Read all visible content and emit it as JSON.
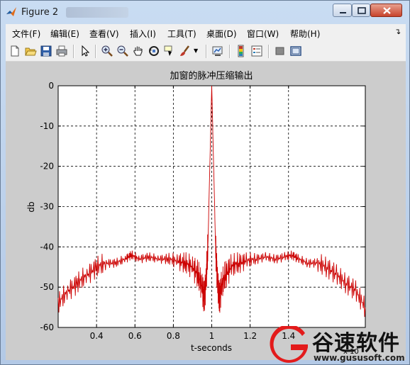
{
  "window": {
    "title": "Figure 2",
    "colors": {
      "accent": "#3a6ea5",
      "close": "#c7432b"
    }
  },
  "menu": [
    {
      "label": "文件(F)"
    },
    {
      "label": "编辑(E)"
    },
    {
      "label": "查看(V)"
    },
    {
      "label": "插入(I)"
    },
    {
      "label": "工具(T)"
    },
    {
      "label": "桌面(D)"
    },
    {
      "label": "窗口(W)"
    },
    {
      "label": "帮助(H)"
    }
  ],
  "toolbar": {
    "icons": [
      "new-figure-icon",
      "open-file-icon",
      "save-icon",
      "print-icon",
      "edit-plot-arrow-icon",
      "zoom-in-icon",
      "zoom-out-icon",
      "pan-hand-icon",
      "rotate-3d-icon",
      "data-cursor-icon",
      "brush-icon",
      "link-plot-icon",
      "colorbar-icon",
      "legend-icon",
      "hide-plot-tools-icon",
      "show-plot-tools-icon"
    ]
  },
  "chart_data": {
    "type": "line",
    "title": "加窗的脉冲压缩输出",
    "xlabel": "t-seconds",
    "ylabel": "db",
    "x_exponent_label": "x 10",
    "xlim": [
      0.2,
      1.8
    ],
    "ylim": [
      -60,
      0
    ],
    "xticks": [
      0.4,
      0.6,
      0.8,
      1.0,
      1.2,
      1.4
    ],
    "xtick_labels": [
      "0.4",
      "0.6",
      "0.8",
      "1",
      "1.2",
      "1.4"
    ],
    "yticks": [
      0,
      -10,
      -20,
      -30,
      -40,
      -50,
      -60
    ],
    "ytick_labels": [
      "0",
      "-10",
      "-20",
      "-30",
      "-40",
      "-50",
      "-60"
    ],
    "grid": true,
    "series": [
      {
        "color": "#cc0000",
        "x": [
          0.2,
          0.25,
          0.3,
          0.35,
          0.4,
          0.45,
          0.5,
          0.55,
          0.58,
          0.62,
          0.67,
          0.72,
          0.77,
          0.82,
          0.86,
          0.9,
          0.93,
          0.95,
          0.96,
          0.97,
          0.98,
          0.99,
          1.0,
          1.01,
          1.02,
          1.03,
          1.04,
          1.05,
          1.07,
          1.1,
          1.14,
          1.18,
          1.23,
          1.28,
          1.33,
          1.38,
          1.42,
          1.45,
          1.5,
          1.55,
          1.6,
          1.65,
          1.7,
          1.75,
          1.8
        ],
        "y": [
          -54,
          -51,
          -49,
          -47,
          -45,
          -44,
          -44,
          -43,
          -42,
          -43,
          -42.5,
          -43,
          -43,
          -43.5,
          -44,
          -45,
          -47,
          -50,
          -53,
          -49,
          -40,
          -20,
          0,
          -20,
          -40,
          -49,
          -53,
          -50,
          -47,
          -45,
          -44,
          -43.5,
          -43,
          -42.5,
          -43,
          -42.5,
          -42,
          -43,
          -44,
          -44,
          -45,
          -47,
          -49,
          -51,
          -55
        ]
      }
    ]
  },
  "watermark": {
    "name": "谷速软件",
    "url": "www.gususoft.com"
  }
}
